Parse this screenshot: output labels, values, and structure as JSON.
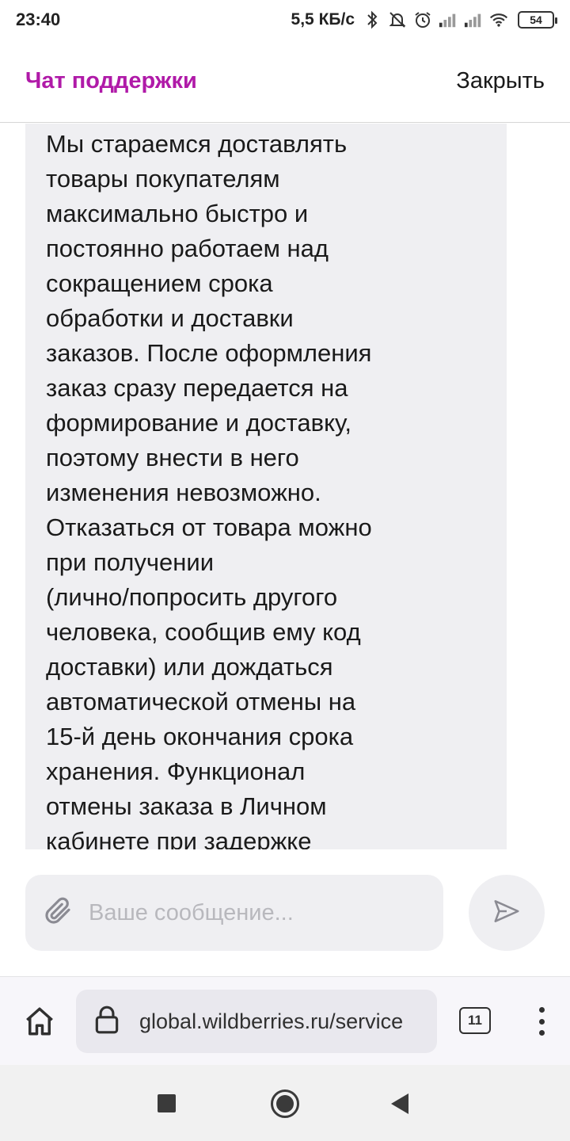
{
  "status_bar": {
    "time": "23:40",
    "net_speed": "5,5 КБ/с",
    "battery": "54",
    "icons": [
      "bluetooth-icon",
      "mute-bell-icon",
      "alarm-icon",
      "signal-icon",
      "signal-icon",
      "wifi-icon",
      "battery-icon"
    ]
  },
  "chat": {
    "title": "Чат поддержки",
    "close_label": "Закрыть",
    "accent_color": "#b01aa8"
  },
  "message": {
    "lines": [
      "Мы стараемся доставлять",
      "товары покупателям",
      "максимально быстро и",
      "постоянно работаем над",
      "сокращением срока",
      "обработки и доставки",
      "заказов. После оформления",
      "заказ сразу передается на",
      "формирование и доставку,",
      "поэтому внести в него",
      "изменения невозможно.",
      "Отказаться от товара можно",
      "при получении",
      "(лично/попросить другого",
      "человека, сообщив ему код",
      "доставки) или дождаться",
      "автоматической отмены на",
      "15-й день окончания срока",
      "хранения. Функционал",
      "отмены заказа в Личном",
      "кабинете при задержке"
    ]
  },
  "composer": {
    "placeholder": "Ваше сообщение...",
    "attach_icon": "paperclip-icon",
    "send_icon": "send-icon"
  },
  "browser": {
    "url": "global.wildberries.ru/service",
    "tab_count": "11",
    "home_icon": "home-icon",
    "lock_icon": "lock-icon",
    "menu_icon": "more-vert-icon"
  },
  "nav": {
    "icons": [
      "recents-icon",
      "home-circle-icon",
      "back-icon"
    ]
  }
}
